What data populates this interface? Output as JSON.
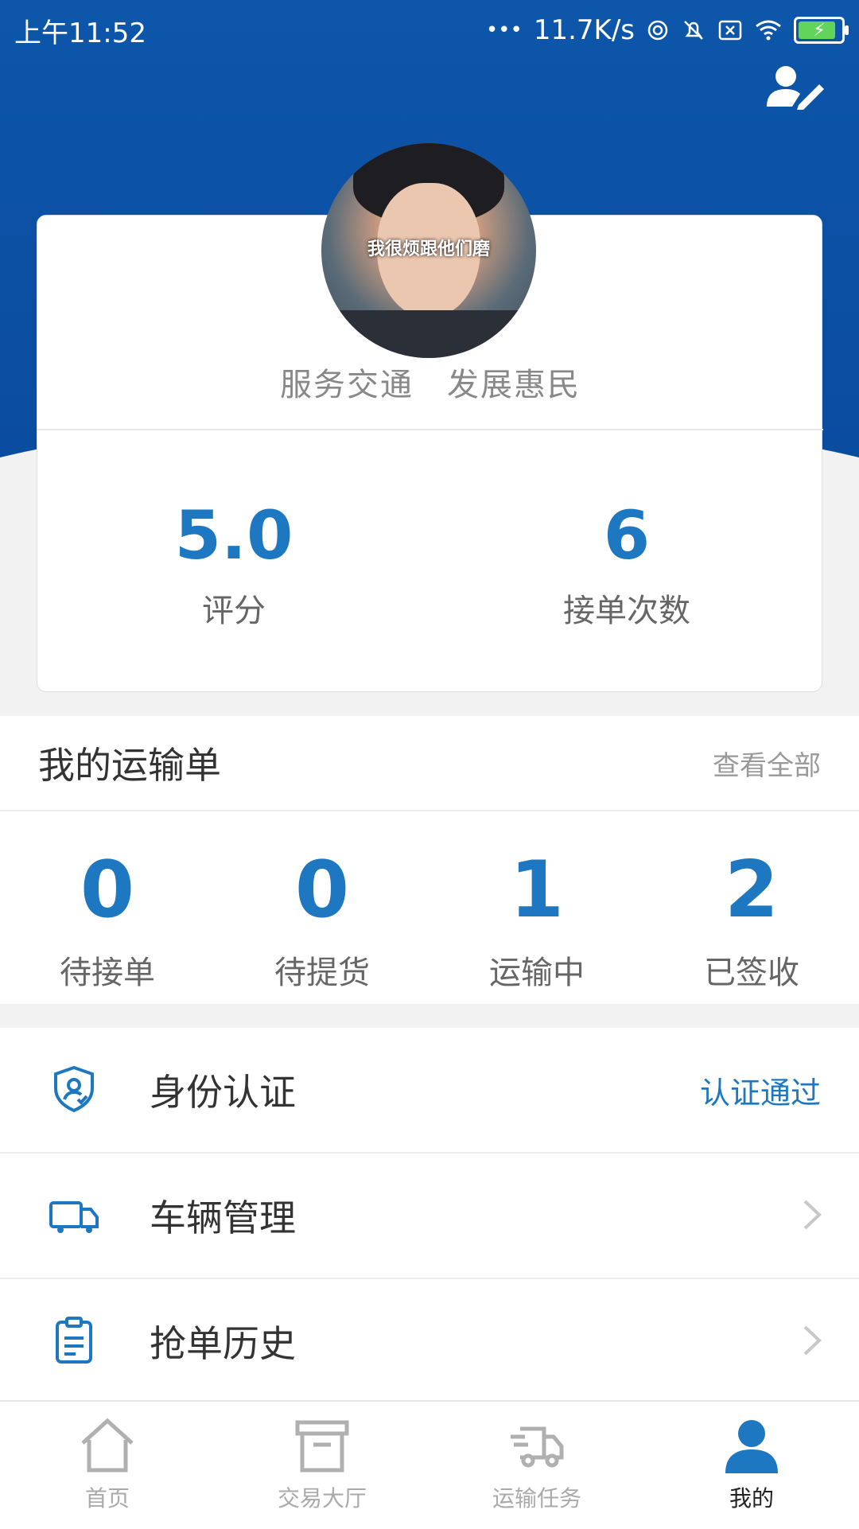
{
  "status_bar": {
    "time": "上午11:52",
    "dots": "•••",
    "network_speed": "11.7K/s"
  },
  "profile": {
    "avatar_caption": "我很烦跟他们磨",
    "slogan": "服务交通　发展惠民",
    "stats": [
      {
        "value": "5.0",
        "label": "评分"
      },
      {
        "value": "6",
        "label": "接单次数"
      }
    ]
  },
  "orders": {
    "title": "我的运输单",
    "view_all": "查看全部",
    "items": [
      {
        "count": "0",
        "label": "待接单"
      },
      {
        "count": "0",
        "label": "待提货"
      },
      {
        "count": "1",
        "label": "运输中"
      },
      {
        "count": "2",
        "label": "已签收"
      }
    ]
  },
  "menu": {
    "items": [
      {
        "label": "身份认证",
        "status": "认证通过",
        "icon": "shield-user-icon"
      },
      {
        "label": "车辆管理",
        "icon": "truck-icon"
      },
      {
        "label": "抢单历史",
        "icon": "clipboard-icon"
      }
    ]
  },
  "tabbar": {
    "items": [
      {
        "label": "首页",
        "icon": "home-icon"
      },
      {
        "label": "交易大厅",
        "icon": "archive-box-icon"
      },
      {
        "label": "运输任务",
        "icon": "delivery-truck-icon"
      },
      {
        "label": "我的",
        "icon": "person-icon",
        "active": true
      }
    ]
  },
  "colors": {
    "header_blue": "#0d56aa",
    "accent_blue": "#1d78c1",
    "battery_green": "#62d45c"
  }
}
